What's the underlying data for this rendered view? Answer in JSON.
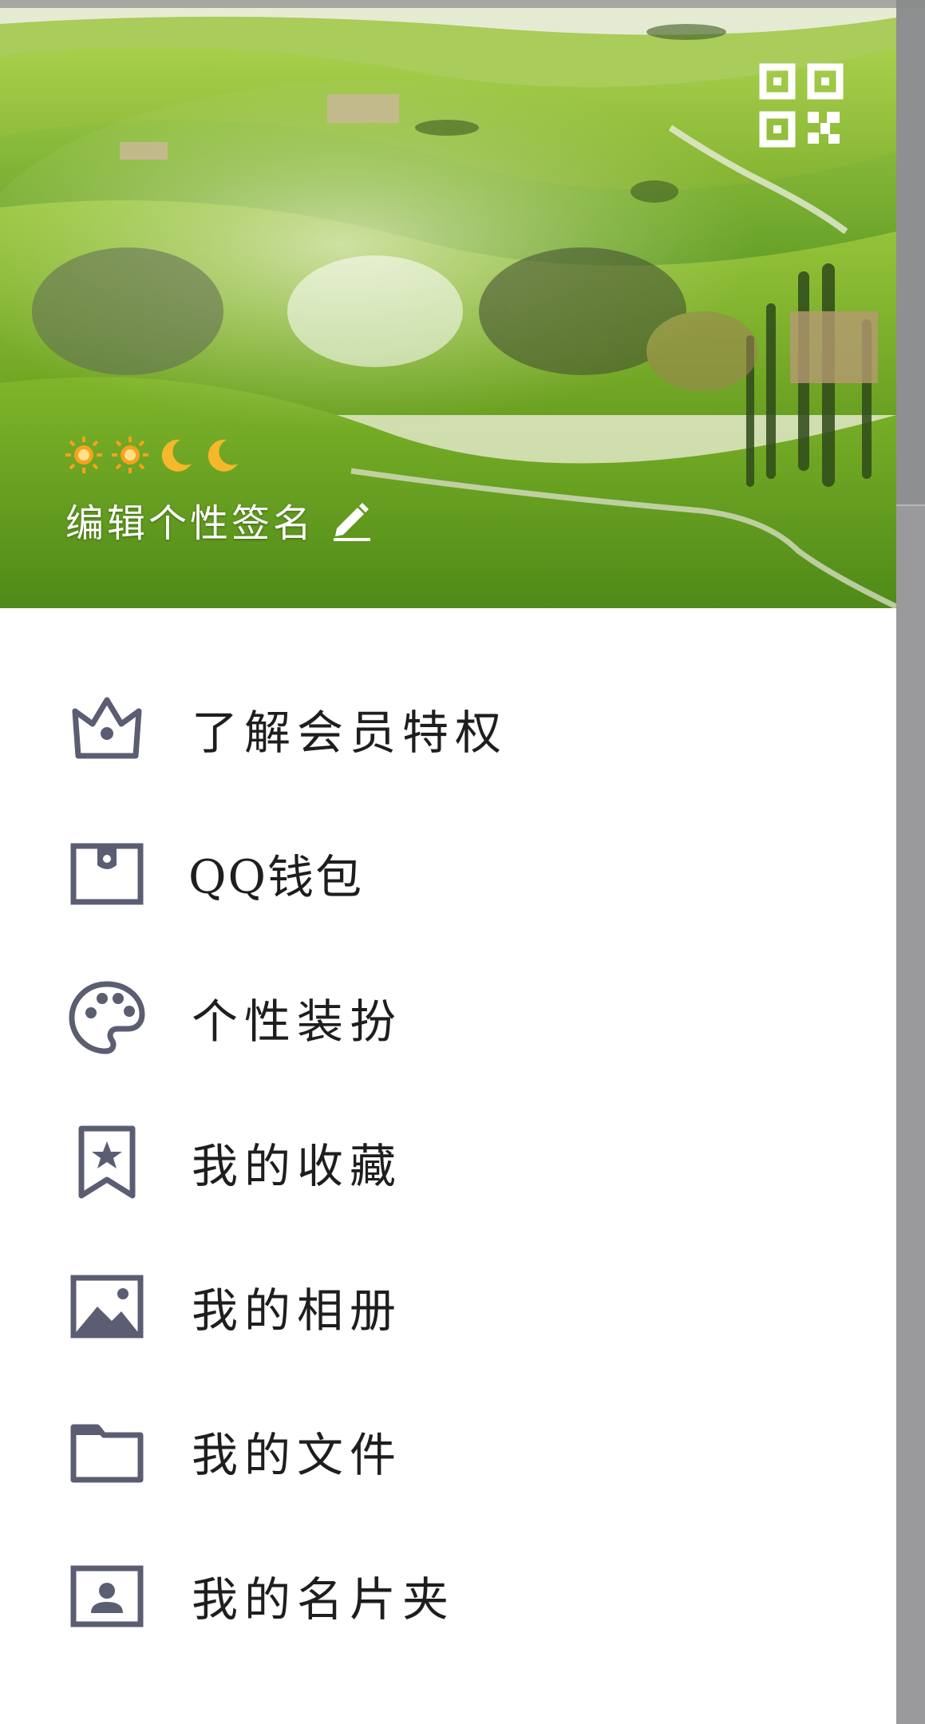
{
  "colors": {
    "icon": "#5b5d73",
    "label": "#1e1e1e",
    "scrim": "#9a9a9c",
    "signature_text": "#ffffff"
  },
  "header": {
    "background_image": "green rolling hills landscape with cypress trees",
    "qr_icon": "qr-code-icon",
    "status_icons": [
      "sun-icon",
      "sun-icon",
      "moon-icon",
      "moon-icon"
    ],
    "signature_label": "编辑个性签名",
    "edit_icon": "pencil-icon"
  },
  "menu": {
    "items": [
      {
        "label": "了解会员特权",
        "icon": "crown-icon"
      },
      {
        "label": "QQ钱包",
        "icon": "wallet-icon"
      },
      {
        "label": "个性装扮",
        "icon": "palette-icon"
      },
      {
        "label": "我的收藏",
        "icon": "bookmark-star-icon"
      },
      {
        "label": "我的相册",
        "icon": "image-icon"
      },
      {
        "label": "我的文件",
        "icon": "folder-icon"
      },
      {
        "label": "我的名片夹",
        "icon": "contact-card-icon"
      }
    ]
  }
}
